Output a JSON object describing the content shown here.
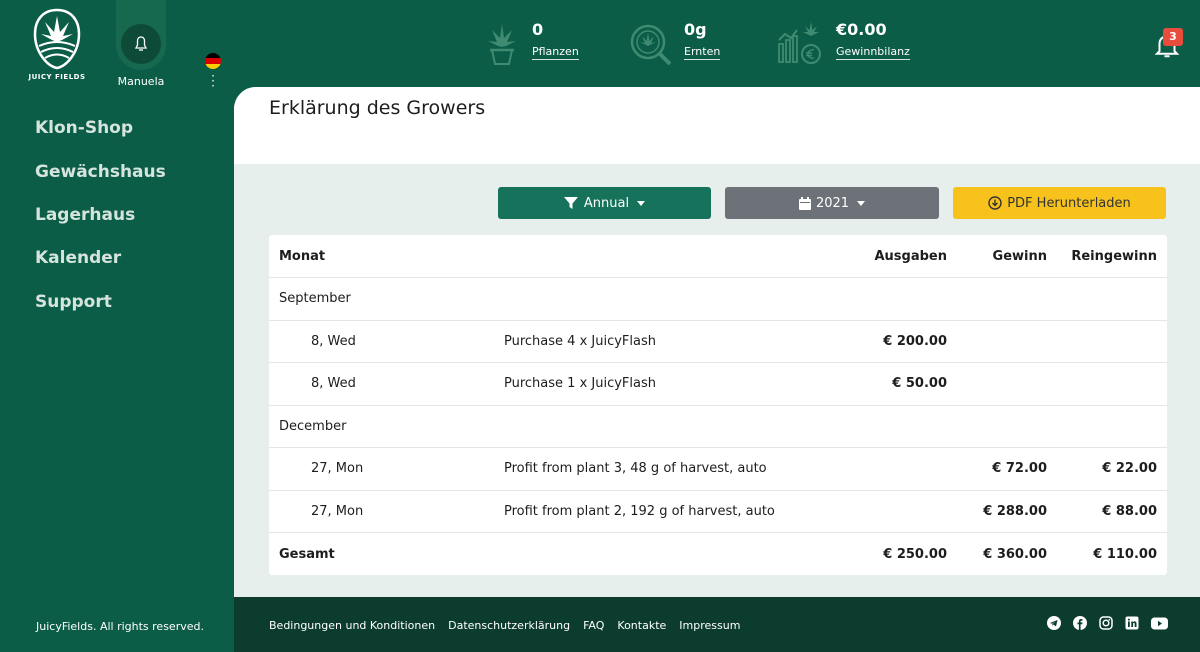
{
  "brand": {
    "name": "JUICY FIELDS"
  },
  "user": {
    "name": "Manuela"
  },
  "stats": [
    {
      "value": "0",
      "label": "Pflanzen",
      "icon": "potted-plant-icon"
    },
    {
      "value": "0g",
      "label": "Ernten",
      "icon": "harvest-magnifier-icon"
    },
    {
      "value": "€0.00",
      "label": "Gewinnbilanz",
      "icon": "profit-balance-icon"
    }
  ],
  "notifications": {
    "count": "3"
  },
  "sidebar": {
    "items": [
      {
        "label": "Klon-Shop"
      },
      {
        "label": "Gewächshaus"
      },
      {
        "label": "Lagerhaus"
      },
      {
        "label": "Kalender"
      },
      {
        "label": "Support"
      }
    ],
    "copyright": "JuicyFields. All rights reserved."
  },
  "page": {
    "title": "Erklärung des Growers"
  },
  "filters": {
    "period": "Annual",
    "year": "2021",
    "pdf_label": "PDF Herunterladen"
  },
  "table": {
    "headers": {
      "month": "Monat",
      "expenses": "Ausgaben",
      "gain": "Gewinn",
      "net": "Reingewinn"
    },
    "groups": [
      {
        "month": "September",
        "rows": [
          {
            "day": "8, Wed",
            "desc": "Purchase 4 x JuicyFlash",
            "expenses": "€ 200.00",
            "gain": "",
            "net": ""
          },
          {
            "day": "8, Wed",
            "desc": "Purchase 1 x JuicyFlash",
            "expenses": "€ 50.00",
            "gain": "",
            "net": ""
          }
        ]
      },
      {
        "month": "December",
        "rows": [
          {
            "day": "27, Mon",
            "desc": "Profit from plant 3, 48 g of harvest, auto",
            "expenses": "",
            "gain": "€ 72.00",
            "net": "€ 22.00"
          },
          {
            "day": "27, Mon",
            "desc": "Profit from plant 2, 192 g of harvest, auto",
            "expenses": "",
            "gain": "€ 288.00",
            "net": "€ 88.00"
          }
        ]
      }
    ],
    "total": {
      "label": "Gesamt",
      "expenses": "€ 250.00",
      "gain": "€ 360.00",
      "net": "€ 110.00"
    }
  },
  "footer": {
    "links": [
      {
        "label": "Bedingungen und Konditionen"
      },
      {
        "label": "Datenschutzerklärung"
      },
      {
        "label": "FAQ"
      },
      {
        "label": "Kontakte"
      },
      {
        "label": "Impressum"
      }
    ],
    "socials": [
      "telegram-icon",
      "facebook-icon",
      "instagram-icon",
      "linkedin-icon",
      "youtube-icon"
    ]
  },
  "colors": {
    "primary_green": "#0b5d47",
    "footer_dark": "#0c3c2e",
    "button_green": "#16725a",
    "button_gray": "#6d7278",
    "button_yellow": "#f6c21b",
    "badge_red": "#e74c3c"
  }
}
